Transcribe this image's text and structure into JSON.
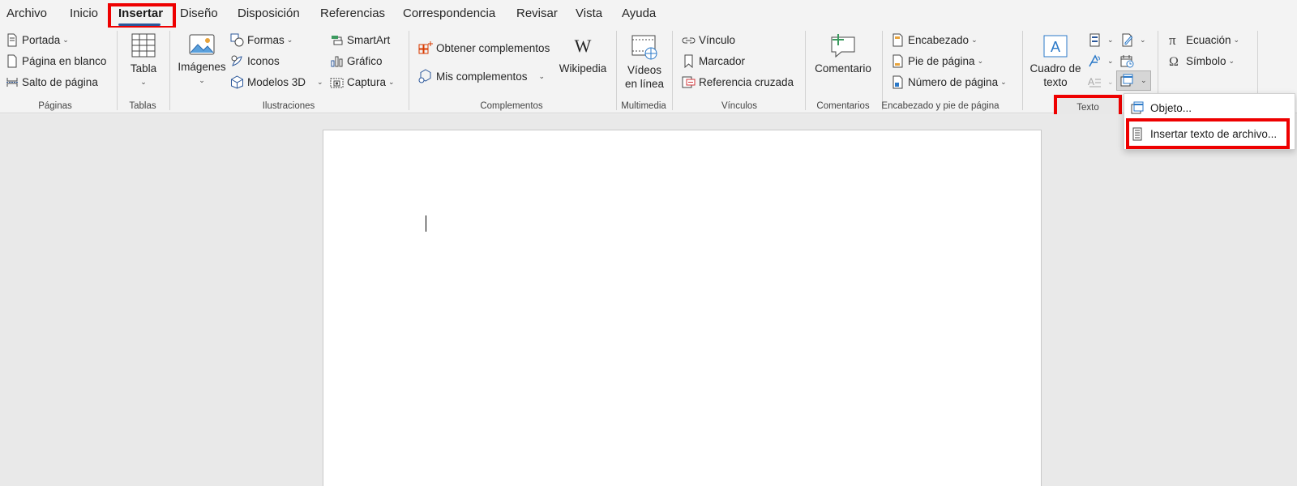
{
  "tabs": [
    "Archivo",
    "Inicio",
    "Insertar",
    "Diseño",
    "Disposición",
    "Referencias",
    "Correspondencia",
    "Revisar",
    "Vista",
    "Ayuda"
  ],
  "active_tab": "Insertar",
  "groups": {
    "paginas": {
      "label": "Páginas",
      "portada": "Portada",
      "pagina_en_blanco": "Página en blanco",
      "salto_de_pagina": "Salto de página"
    },
    "tablas": {
      "label": "Tablas",
      "tabla": "Tabla"
    },
    "ilustraciones": {
      "label": "Ilustraciones",
      "imagenes": "Imágenes",
      "formas": "Formas",
      "iconos": "Iconos",
      "modelos_3d": "Modelos 3D",
      "smartart": "SmartArt",
      "grafico": "Gráfico",
      "captura": "Captura"
    },
    "complementos": {
      "label": "Complementos",
      "obtener": "Obtener complementos",
      "mis": "Mis complementos",
      "wikipedia": "Wikipedia"
    },
    "multimedia": {
      "label": "Multimedia",
      "videos_line1": "Vídeos",
      "videos_line2": "en línea"
    },
    "vinculos": {
      "label": "Vínculos",
      "vinculo": "Vínculo",
      "marcador": "Marcador",
      "referencia_cruzada": "Referencia cruzada"
    },
    "comentarios": {
      "label": "Comentarios",
      "comentario": "Comentario"
    },
    "encabezado": {
      "label": "Encabezado y pie de página",
      "encabezado": "Encabezado",
      "pie_de_pagina": "Pie de página",
      "numero_de_pagina": "Número de página"
    },
    "texto": {
      "label": "Texto",
      "cuadro_line1": "Cuadro de",
      "cuadro_line2": "texto"
    },
    "simbolos": {
      "ecuacion": "Ecuación",
      "simbolo": "Símbolo"
    }
  },
  "object_menu": {
    "items": [
      "Objeto...",
      "Insertar texto de archivo..."
    ]
  },
  "colors": {
    "accent": "#2b579a",
    "highlight": "#ee0000"
  }
}
